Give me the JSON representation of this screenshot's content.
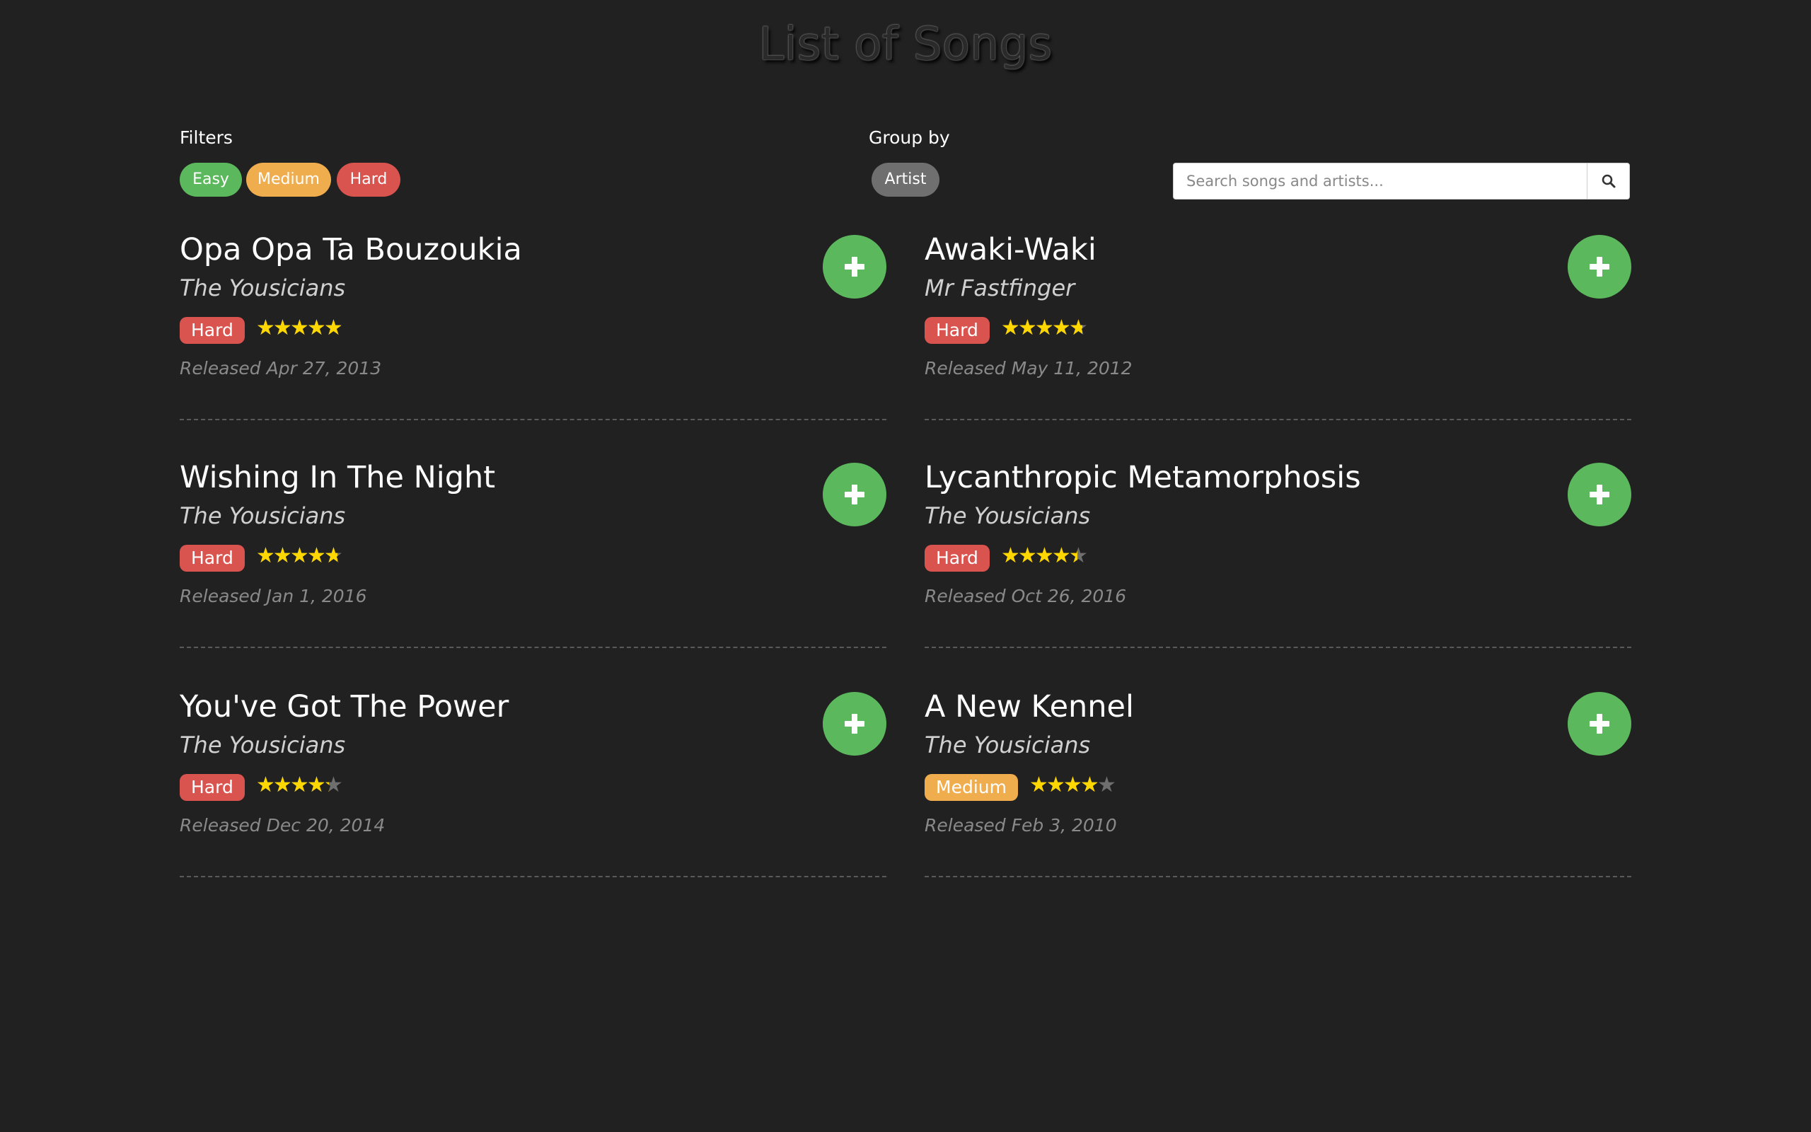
{
  "page": {
    "title": "List of Songs"
  },
  "filters": {
    "label": "Filters",
    "options": [
      "Easy",
      "Medium",
      "Hard"
    ]
  },
  "group_by": {
    "label": "Group by",
    "option": "Artist"
  },
  "search": {
    "placeholder": "Search songs and artists...",
    "value": ""
  },
  "colors": {
    "easy": "#5cb85c",
    "medium": "#f0ad4e",
    "hard": "#d9534f",
    "add_button": "#5cb85c",
    "star": "#ffd700"
  },
  "songs": [
    {
      "title": "Opa Opa Ta Bouzoukia",
      "artist": "The Yousicians",
      "difficulty": "Hard",
      "rating": 5,
      "released": "Released Apr 27, 2013"
    },
    {
      "title": "Awaki-Waki",
      "artist": "Mr Fastfinger",
      "difficulty": "Hard",
      "rating": 4.8,
      "released": "Released May 11, 2012"
    },
    {
      "title": "Wishing In The Night",
      "artist": "The Yousicians",
      "difficulty": "Hard",
      "rating": 4.8,
      "released": "Released Jan 1, 2016"
    },
    {
      "title": "Lycanthropic Metamorphosis",
      "artist": "The Yousicians",
      "difficulty": "Hard",
      "rating": 4.5,
      "released": "Released Oct 26, 2016"
    },
    {
      "title": "You've Got The Power",
      "artist": "The Yousicians",
      "difficulty": "Hard",
      "rating": 4.3,
      "released": "Released Dec 20, 2014"
    },
    {
      "title": "A New Kennel",
      "artist": "The Yousicians",
      "difficulty": "Medium",
      "rating": 4,
      "released": "Released Feb 3, 2010"
    }
  ]
}
